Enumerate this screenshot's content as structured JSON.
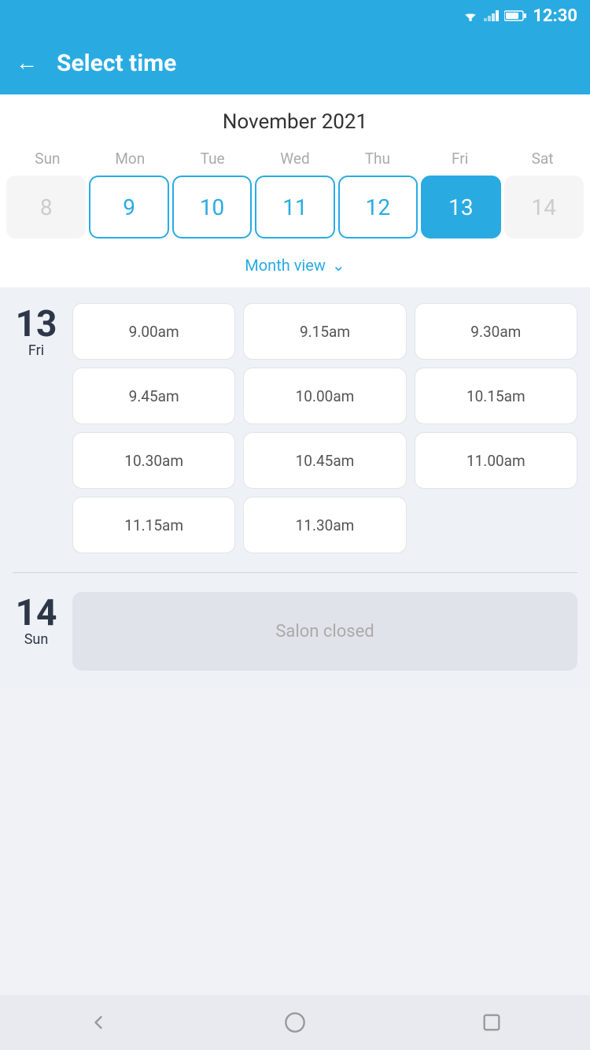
{
  "statusBar": {
    "time": "12:30"
  },
  "header": {
    "title": "Select time",
    "backLabel": "←"
  },
  "calendar": {
    "monthYear": "November 2021",
    "dayHeaders": [
      "Sun",
      "Mon",
      "Tue",
      "Wed",
      "Thu",
      "Fri",
      "Sat"
    ],
    "days": [
      {
        "number": "8",
        "state": "inactive"
      },
      {
        "number": "9",
        "state": "active"
      },
      {
        "number": "10",
        "state": "active"
      },
      {
        "number": "11",
        "state": "active"
      },
      {
        "number": "12",
        "state": "active"
      },
      {
        "number": "13",
        "state": "selected"
      },
      {
        "number": "14",
        "state": "inactive"
      }
    ],
    "monthViewLabel": "Month view"
  },
  "timeSlots": {
    "day": {
      "number": "13",
      "name": "Fri"
    },
    "slots": [
      "9.00am",
      "9.15am",
      "9.30am",
      "9.45am",
      "10.00am",
      "10.15am",
      "10.30am",
      "10.45am",
      "11.00am",
      "11.15am",
      "11.30am"
    ]
  },
  "closedDay": {
    "number": "14",
    "name": "Sun",
    "message": "Salon closed"
  },
  "bottomNav": {
    "back": "back",
    "home": "home",
    "recent": "recent"
  }
}
